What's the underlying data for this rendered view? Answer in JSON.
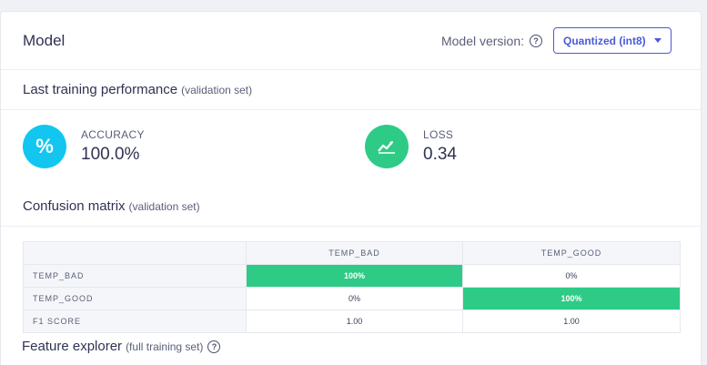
{
  "header": {
    "title": "Model",
    "version_label": "Model version:",
    "version_value": "Quantized (int8)"
  },
  "performance": {
    "title": "Last training performance",
    "subtitle": "(validation set)",
    "accuracy": {
      "label": "ACCURACY",
      "value": "100.0%",
      "icon": "percent-icon",
      "color": "#12c6ef"
    },
    "loss": {
      "label": "LOSS",
      "value": "0.34",
      "icon": "chart-line-icon",
      "color": "#2ecb87"
    }
  },
  "confusion": {
    "title": "Confusion matrix",
    "subtitle": "(validation set)",
    "columns": [
      "",
      "TEMP_BAD",
      "TEMP_GOOD"
    ],
    "rows": [
      {
        "label": "TEMP_BAD",
        "cells": [
          "100%",
          "0%"
        ]
      },
      {
        "label": "TEMP_GOOD",
        "cells": [
          "0%",
          "100%"
        ]
      },
      {
        "label": "F1 SCORE",
        "cells": [
          "1.00",
          "1.00"
        ]
      }
    ]
  },
  "feature": {
    "title": "Feature explorer",
    "subtitle": "(full training set)"
  }
}
